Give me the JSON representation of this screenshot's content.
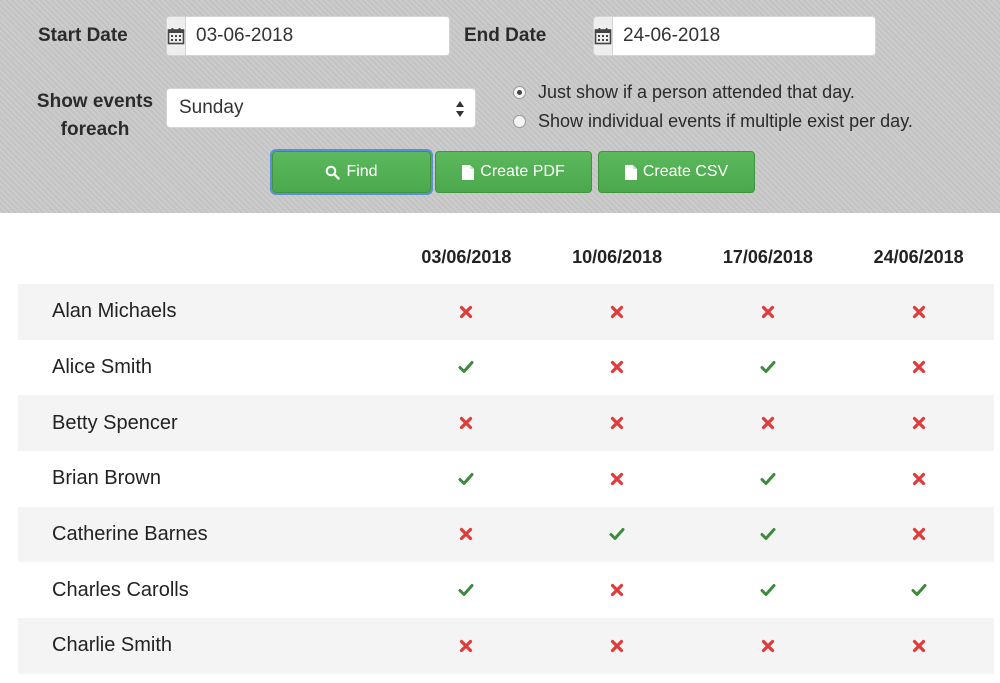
{
  "filters": {
    "start_date_label": "Start Date",
    "start_date_value": "03-06-2018",
    "end_date_label": "End Date",
    "end_date_value": "24-06-2018",
    "show_events_label_line1": "Show events",
    "show_events_label_line2": "foreach",
    "day_select_value": "Sunday",
    "radio_options": [
      {
        "label": "Just show if a person attended that day.",
        "checked": true
      },
      {
        "label": "Show individual events if multiple exist per day.",
        "checked": false
      }
    ]
  },
  "buttons": {
    "find": "Find",
    "create_pdf": "Create PDF",
    "create_csv": "Create CSV"
  },
  "colors": {
    "button_green": "#5cb85c",
    "present_check": "#3c8a3c",
    "absent_cross": "#e03a3a"
  },
  "table": {
    "dates": [
      "03/06/2018",
      "10/06/2018",
      "17/06/2018",
      "24/06/2018"
    ],
    "rows": [
      {
        "name": "Alan Michaels",
        "attendance": [
          false,
          false,
          false,
          false
        ]
      },
      {
        "name": "Alice Smith",
        "attendance": [
          true,
          false,
          true,
          false
        ]
      },
      {
        "name": "Betty Spencer",
        "attendance": [
          false,
          false,
          false,
          false
        ]
      },
      {
        "name": "Brian Brown",
        "attendance": [
          true,
          false,
          true,
          false
        ]
      },
      {
        "name": "Catherine Barnes",
        "attendance": [
          false,
          true,
          true,
          false
        ]
      },
      {
        "name": "Charles Carolls",
        "attendance": [
          true,
          false,
          true,
          true
        ]
      },
      {
        "name": "Charlie Smith",
        "attendance": [
          false,
          false,
          false,
          false
        ]
      }
    ]
  }
}
